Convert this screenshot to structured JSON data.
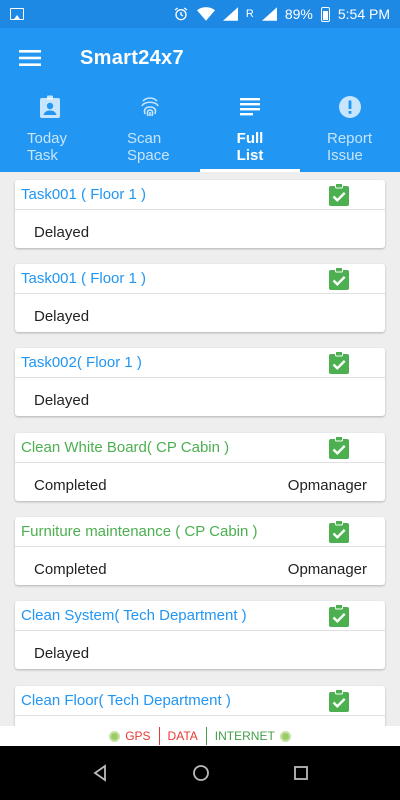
{
  "status_bar": {
    "network_label": "R",
    "battery": "89%",
    "time": "5:54 PM"
  },
  "app_bar": {
    "title": "Smart24x7"
  },
  "tabs": [
    {
      "label": "Today\nTask",
      "icon": "assignment-ind-icon"
    },
    {
      "label": "Scan\nSpace",
      "icon": "fingerprint-icon"
    },
    {
      "label": "Full\nList",
      "icon": "list-icon",
      "active": true
    },
    {
      "label": "Report\nIssue",
      "icon": "error-icon"
    }
  ],
  "tasks": [
    {
      "title": "Task001 ( Floor 1 )",
      "status": "Delayed",
      "assignee": "",
      "title_color": "blue"
    },
    {
      "title": "Task001 ( Floor 1 )",
      "status": "Delayed",
      "assignee": "",
      "title_color": "blue"
    },
    {
      "title": "Task002( Floor 1 )",
      "status": "Delayed",
      "assignee": "",
      "title_color": "blue"
    },
    {
      "title": "Clean White Board( CP Cabin )",
      "status": "Completed",
      "assignee": "Opmanager",
      "title_color": "green"
    },
    {
      "title": "Furniture maintenance ( CP Cabin )",
      "status": "Completed",
      "assignee": "Opmanager",
      "title_color": "green"
    },
    {
      "title": "Clean System( Tech Department )",
      "status": "Delayed",
      "assignee": "",
      "title_color": "blue"
    },
    {
      "title": "Clean Floor( Tech Department )",
      "status": "",
      "assignee": "",
      "title_color": "blue"
    }
  ],
  "footer": {
    "gps": "GPS",
    "data": "DATA",
    "internet": "INTERNET"
  },
  "colors": {
    "primary": "#2196f3",
    "status_bar": "#1e88e5",
    "completed": "#4caf50",
    "alert": "#e53935"
  }
}
